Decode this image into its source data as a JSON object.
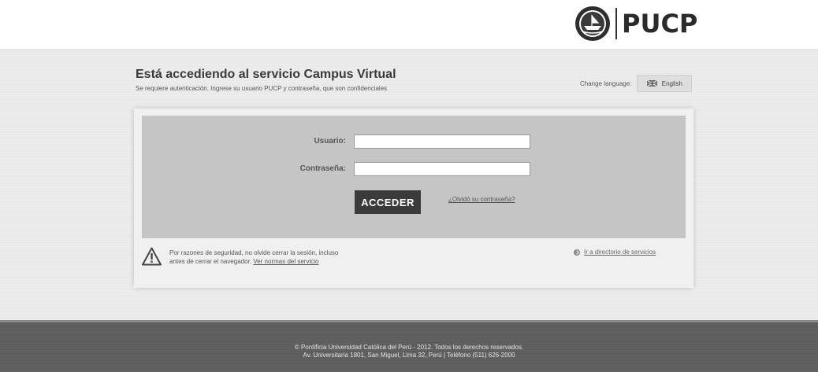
{
  "header": {
    "logo_text": "PUCP",
    "seal_icon": "university-seal-icon"
  },
  "main": {
    "title": "Está accediendo al servicio Campus Virtual",
    "subtitle": "Se requiere autenticación. Ingrese su usuario PUCP y contraseña, que son confidenciales",
    "language": {
      "label": "Change language:",
      "button_label": "English",
      "flag_icon": "uk-flag-icon"
    }
  },
  "login": {
    "username_label": "Usuario:",
    "username_value": "",
    "password_label": "Contraseña:",
    "password_value": "",
    "submit_label": "ACCEDER",
    "forgot_label": "¿Olvidó su contraseña?"
  },
  "notice": {
    "text_line1": "Por razones de seguridad, no olvide cerrar la sesión, incluso",
    "text_line2": "antes de cerrar el navegador.",
    "link_label": "Ver normas del servicio",
    "icon": "warning-icon"
  },
  "directory_link": {
    "label": "Ir a directorio de servicios",
    "icon": "arrow-circle-icon"
  },
  "footer": {
    "line1": "© Pontificia Universidad Católica del Perú - 2012. Todos los derechos reservados.",
    "line2": "Av. Universitaria 1801, San Miguel, Lima 32, Perú | Teléfono (511) 626-2000"
  },
  "colors": {
    "band": "#e9e9e9",
    "form_area": "#c5c5c5",
    "button": "#3b3b3b",
    "footer": "#5d5d5d"
  }
}
